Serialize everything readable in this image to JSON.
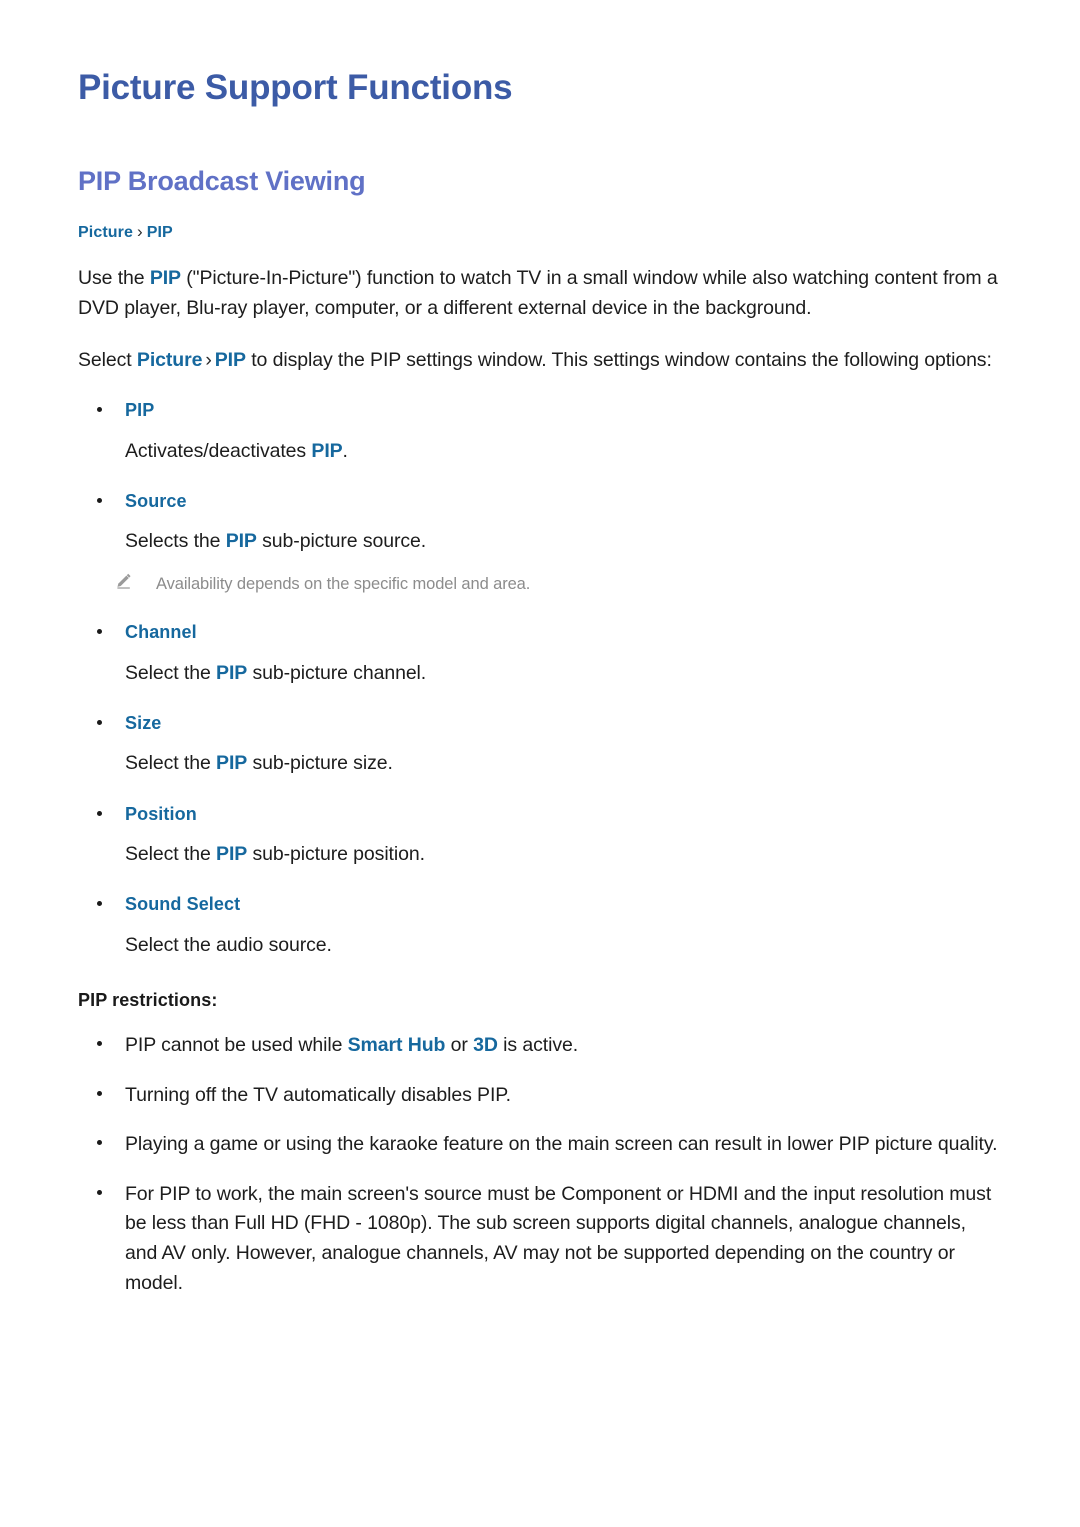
{
  "colors": {
    "doc_title": "#3c5ba6",
    "section_title": "#6071c6",
    "link_blue": "#16689e",
    "body_text": "#1d1d1d",
    "note_grey": "#8c8c8c",
    "page_background": "#ffffff"
  },
  "document": {
    "title": "Picture Support Functions",
    "section_title": "PIP Broadcast Viewing"
  },
  "breadcrumb": {
    "root": "Picture",
    "separator": "›",
    "leaf": "PIP"
  },
  "intro": {
    "para1_a": "Use the ",
    "para1_link": "PIP",
    "para1_b": " (\"Picture-In-Picture\") function to watch TV in a small window while also watching content from a DVD player, Blu-ray player, computer, or a different external device in the background.",
    "para2_a": "Select ",
    "para2_link1": "Picture",
    "para2_sep": "›",
    "para2_link2": "PIP",
    "para2_b": " to display the PIP settings window. This settings window contains the following options:"
  },
  "options": [
    {
      "label": "PIP",
      "desc_a": "Activates/deactivates ",
      "desc_link": "PIP",
      "desc_b": ".",
      "note": null
    },
    {
      "label": "Source",
      "desc_a": "Selects the ",
      "desc_link": "PIP",
      "desc_b": " sub-picture source.",
      "note": "Availability depends on the specific model and area."
    },
    {
      "label": "Channel",
      "desc_a": "Select the ",
      "desc_link": "PIP",
      "desc_b": " sub-picture channel.",
      "note": null
    },
    {
      "label": "Size",
      "desc_a": "Select the ",
      "desc_link": "PIP",
      "desc_b": " sub-picture size.",
      "note": null
    },
    {
      "label": "Position",
      "desc_a": "Select the ",
      "desc_link": "PIP",
      "desc_b": " sub-picture position.",
      "note": null
    },
    {
      "label": "Sound Select",
      "desc_a": "Select the audio source.",
      "desc_link": "",
      "desc_b": "",
      "note": null
    }
  ],
  "restrictions": {
    "title": "PIP restrictions:",
    "items": [
      {
        "a": "PIP cannot be used while ",
        "link1": "Smart Hub",
        "mid": " or ",
        "link2": "3D",
        "b": " is active."
      },
      {
        "a": "Turning off the TV automatically disables PIP.",
        "link1": "",
        "mid": "",
        "link2": "",
        "b": ""
      },
      {
        "a": "Playing a game or using the karaoke feature on the main screen can result in lower PIP picture quality.",
        "link1": "",
        "mid": "",
        "link2": "",
        "b": ""
      },
      {
        "a": "For PIP to work, the main screen's source must be Component or HDMI and the input resolution must be less than Full HD (FHD - 1080p). The sub screen supports digital channels, analogue channels, and AV only. However, analogue channels, AV may not be supported depending on the country or model.",
        "link1": "",
        "mid": "",
        "link2": "",
        "b": ""
      }
    ]
  },
  "icons": {
    "note": "pencil-icon"
  }
}
